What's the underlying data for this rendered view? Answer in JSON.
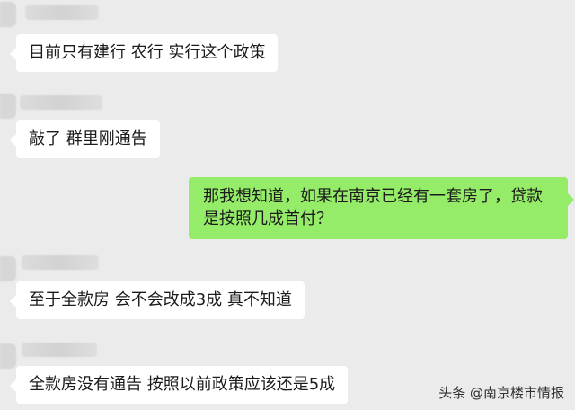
{
  "messages": [
    {
      "side": "left",
      "text": "目前只有建行 农行 实行这个政策"
    },
    {
      "side": "left",
      "text": "敲了 群里刚通告"
    },
    {
      "side": "right",
      "text": "那我想知道，如果在南京已经有一套房了，贷款是按照几成首付？"
    },
    {
      "side": "left",
      "text": "至于全款房 会不会改成3成 真不知道"
    },
    {
      "side": "left",
      "text": "全款房没有通告 按照以前政策应该还是5成"
    }
  ],
  "watermark": "头条 @南京楼市情报",
  "colors": {
    "background": "#ebebeb",
    "incoming_bubble": "#ffffff",
    "outgoing_bubble": "#95ec69"
  }
}
